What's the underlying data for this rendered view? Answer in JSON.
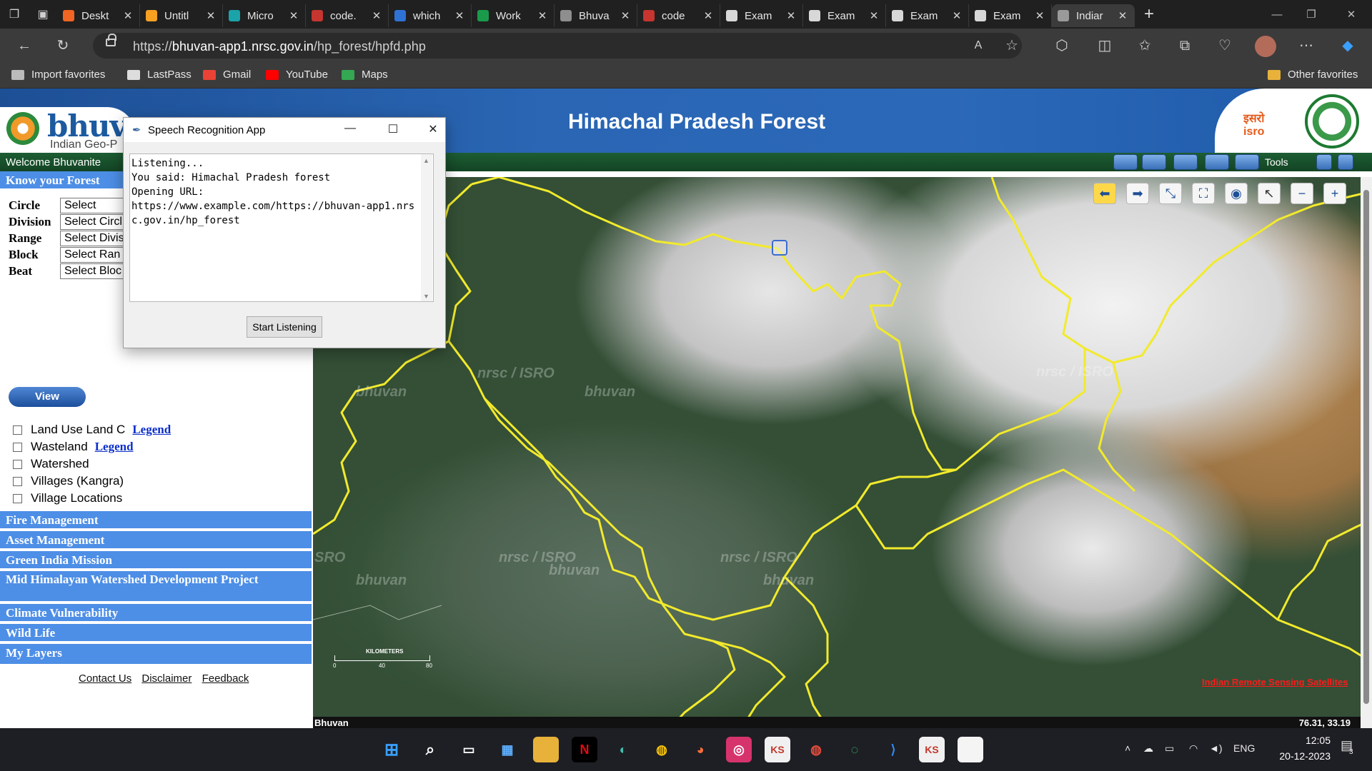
{
  "browser": {
    "tabs": [
      {
        "label": "Deskt",
        "color": "#f26522"
      },
      {
        "label": "Untitl",
        "color": "#f7a021"
      },
      {
        "label": "Micro",
        "color": "#1aa3a8"
      },
      {
        "label": "code.",
        "color": "#c6352f"
      },
      {
        "label": "which",
        "color": "#2f72d6"
      },
      {
        "label": "Work",
        "color": "#1a9b4b"
      },
      {
        "label": "Bhuva",
        "color": "#8e8e8e"
      },
      {
        "label": "code",
        "color": "#c6352f"
      },
      {
        "label": "Exam",
        "color": "#d8d8d8"
      },
      {
        "label": "Exam",
        "color": "#d8d8d8"
      },
      {
        "label": "Exam",
        "color": "#d8d8d8"
      },
      {
        "label": "Exam",
        "color": "#d8d8d8"
      },
      {
        "label": "Indiar",
        "color": "#9a9a9a",
        "active": true
      }
    ],
    "url_prefix": "https://",
    "url_host": "bhuvan-app1.nrsc.gov.in",
    "url_path": "/hp_forest/hpfd.php",
    "favorites": [
      {
        "label": "Import favorites",
        "color": "#bbbbbb"
      },
      {
        "label": "LastPass",
        "color": "#dddddd"
      },
      {
        "label": "Gmail",
        "color": "#ea4335"
      },
      {
        "label": "YouTube",
        "color": "#ff0000"
      },
      {
        "label": "Maps",
        "color": "#34a853"
      }
    ],
    "other_favorites": "Other favorites"
  },
  "site": {
    "title": "Himachal Pradesh Forest",
    "logo_text": "bhuvan",
    "logo_sub": "Indian Geo-P",
    "isro_text": "इसरो isro",
    "welcome": "Welcome Bhuvanite",
    "tools_label": "Tools"
  },
  "left": {
    "know_forest": "Know your Forest",
    "fields": [
      {
        "label": "Circle",
        "value": "Select"
      },
      {
        "label": "Division",
        "value": "Select Circl"
      },
      {
        "label": "Range",
        "value": "Select Divis"
      },
      {
        "label": "Block",
        "value": "Select Ran"
      },
      {
        "label": "Beat",
        "value": "Select Bloc"
      }
    ],
    "view_button": "View",
    "layers": [
      {
        "label": "Land Use Land C",
        "legend": "Legend"
      },
      {
        "label": "Wasteland",
        "legend": "Legend"
      },
      {
        "label": "Watershed"
      },
      {
        "label": "Villages (Kangra)"
      },
      {
        "label": "Village Locations"
      }
    ],
    "sections": [
      "Fire Management",
      "Asset Management",
      "Green India Mission",
      "Mid Himalayan Watershed Development Project",
      "Climate Vulnerability",
      "Wild Life",
      "My Layers"
    ],
    "footer": [
      "Contact Us",
      "Disclaimer",
      "Feedback"
    ]
  },
  "map": {
    "watermarks": [
      "nrsc / ISRO",
      "bhuvan",
      "nrsc / ISRO",
      "bhuvan",
      "nrsc / ISRO",
      "bhuvan",
      "nrsc / ISRO",
      "bhuvan",
      "SRO",
      "bhuvan"
    ],
    "irs_label": "Indian Remote Sensing Satellites",
    "scale_label": "KILOMETERS",
    "scale_ticks": [
      "0",
      "40",
      "80"
    ],
    "status_left": "Bhuvan",
    "coords": "76.31, 33.19",
    "tool_icons": [
      "back-arrow",
      "forward-arrow",
      "zoom-extent",
      "full-extent",
      "globe",
      "select",
      "zoom-out",
      "zoom-in"
    ]
  },
  "speech_app": {
    "title": "Speech Recognition App",
    "text": "Listening...\nYou said: Himachal Pradesh forest\nOpening URL:\nhttps://www.example.com/https://bhuvan-app1.nrsc.gov.in/hp_forest",
    "button": "Start Listening"
  },
  "taskbar": {
    "lang": "ENG",
    "time": "12:05",
    "date": "20-12-2023",
    "notifications": "3"
  }
}
